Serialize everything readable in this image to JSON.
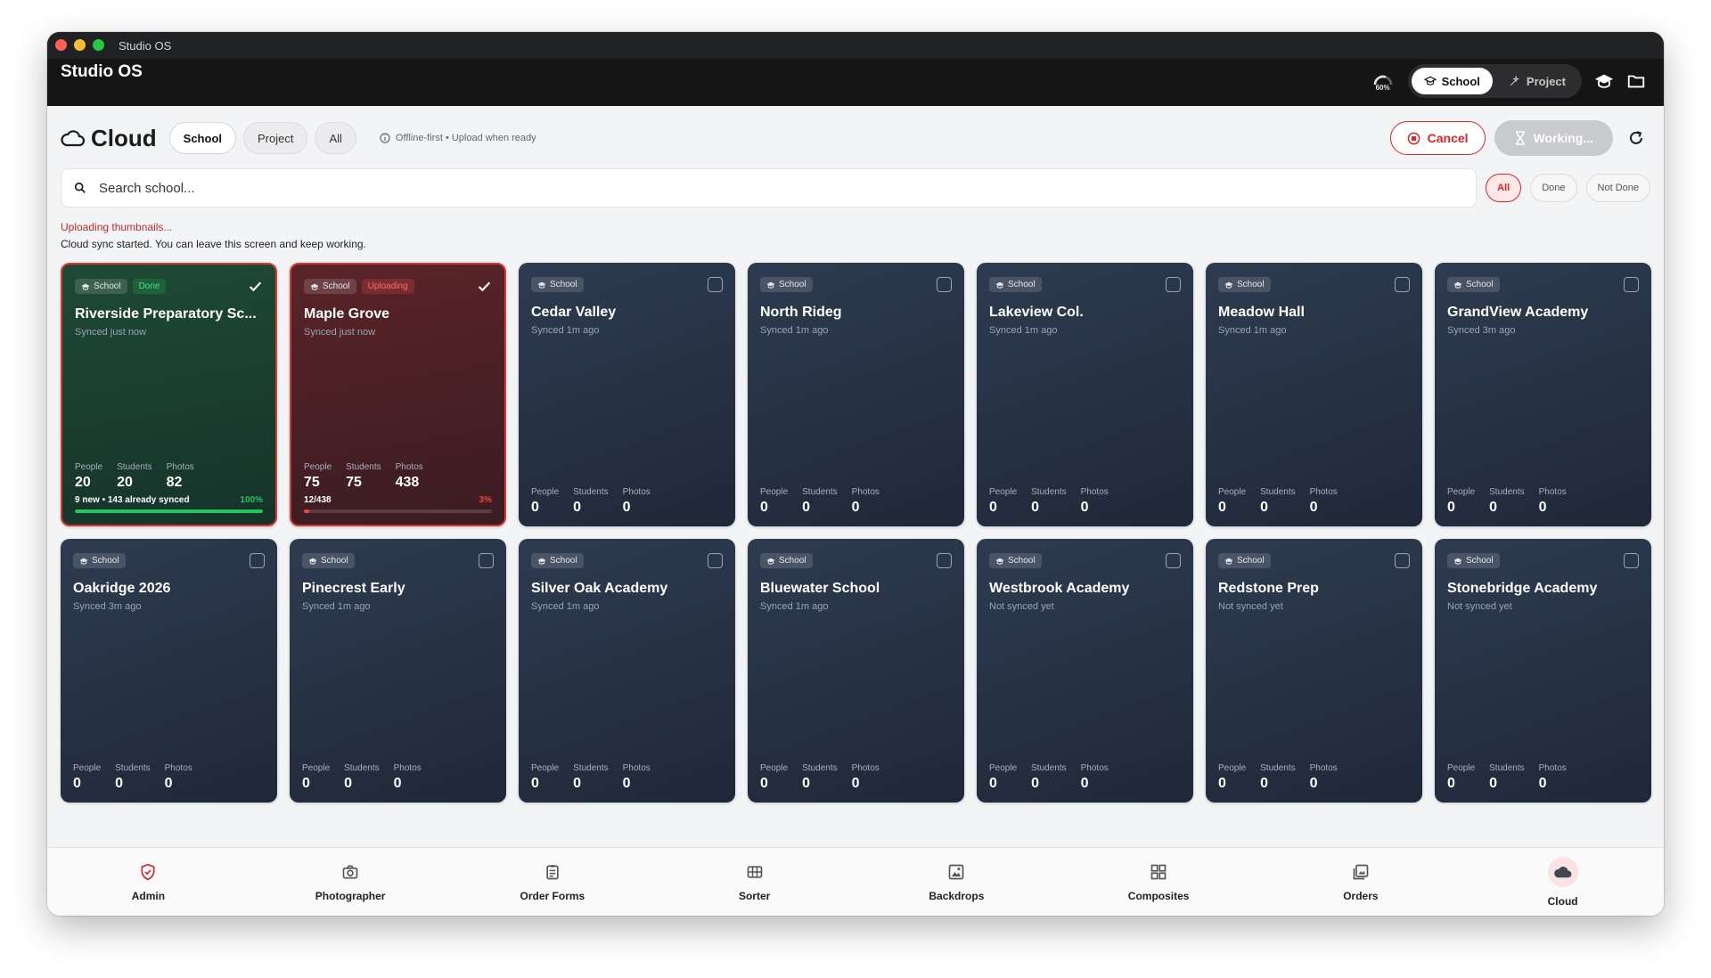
{
  "window": {
    "name": "Studio OS",
    "app_title": "Studio OS"
  },
  "topbar": {
    "battery_label": "60%",
    "modes": [
      {
        "label": "School",
        "icon": "graduation-cap-icon",
        "active": true
      },
      {
        "label": "Project",
        "icon": "sparkle-icon",
        "active": false
      }
    ]
  },
  "header": {
    "title": "Cloud",
    "tabs": [
      {
        "label": "School",
        "active": true
      },
      {
        "label": "Project",
        "active": false
      },
      {
        "label": "All",
        "active": false
      }
    ],
    "offline_note": "Offline-first • Upload when ready",
    "cancel_label": "Cancel",
    "working_label": "Working..."
  },
  "search": {
    "placeholder": "Search school..."
  },
  "filters": [
    {
      "label": "All",
      "active": true
    },
    {
      "label": "Done",
      "active": false
    },
    {
      "label": "Not Done",
      "active": false
    }
  ],
  "status": {
    "line1": "Uploading thumbnails...",
    "line2": "Cloud sync started. You can leave this screen and keep working."
  },
  "stat_labels": {
    "people": "People",
    "students": "Students",
    "photos": "Photos"
  },
  "cards": [
    {
      "name": "Riverside Preparatory Sc...",
      "badge": "School",
      "state_badge": "Done",
      "state": "done",
      "synced": "Synced just now",
      "people": "20",
      "students": "20",
      "photos": "82",
      "checked": true,
      "progress_text": "9 new • 143 already synced",
      "progress_pct": "100%",
      "progress": 1.0
    },
    {
      "name": "Maple Grove",
      "badge": "School",
      "state_badge": "Uploading",
      "state": "uploading",
      "synced": "Synced just now",
      "people": "75",
      "students": "75",
      "photos": "438",
      "checked": true,
      "progress_text": "12/438",
      "progress_pct": "3%",
      "progress": 0.03
    },
    {
      "name": "Cedar Valley",
      "badge": "School",
      "synced": "Synced 1m ago",
      "people": "0",
      "students": "0",
      "photos": "0",
      "checked": false
    },
    {
      "name": "North Rideg",
      "badge": "School",
      "synced": "Synced 1m ago",
      "people": "0",
      "students": "0",
      "photos": "0",
      "checked": false
    },
    {
      "name": "Lakeview Col.",
      "badge": "School",
      "synced": "Synced 1m ago",
      "people": "0",
      "students": "0",
      "photos": "0",
      "checked": false
    },
    {
      "name": "Meadow Hall",
      "badge": "School",
      "synced": "Synced 1m ago",
      "people": "0",
      "students": "0",
      "photos": "0",
      "checked": false
    },
    {
      "name": "GrandView Academy",
      "badge": "School",
      "synced": "Synced 3m ago",
      "people": "0",
      "students": "0",
      "photos": "0",
      "checked": false
    },
    {
      "name": "Oakridge 2026",
      "badge": "School",
      "synced": "Synced 3m ago",
      "people": "0",
      "students": "0",
      "photos": "0",
      "checked": false
    },
    {
      "name": "Pinecrest Early",
      "badge": "School",
      "synced": "Synced 1m ago",
      "people": "0",
      "students": "0",
      "photos": "0",
      "checked": false
    },
    {
      "name": "Silver Oak Academy",
      "badge": "School",
      "synced": "Synced 1m ago",
      "people": "0",
      "students": "0",
      "photos": "0",
      "checked": false
    },
    {
      "name": "Bluewater School",
      "badge": "School",
      "synced": "Synced 1m ago",
      "people": "0",
      "students": "0",
      "photos": "0",
      "checked": false
    },
    {
      "name": "Westbrook Academy",
      "badge": "School",
      "synced": "Not synced yet",
      "people": "0",
      "students": "0",
      "photos": "0",
      "checked": false
    },
    {
      "name": "Redstone Prep",
      "badge": "School",
      "synced": "Not synced yet",
      "people": "0",
      "students": "0",
      "photos": "0",
      "checked": false
    },
    {
      "name": "Stonebridge Academy",
      "badge": "School",
      "synced": "Not synced yet",
      "people": "0",
      "students": "0",
      "photos": "0",
      "checked": false
    }
  ],
  "nav": [
    {
      "label": "Admin",
      "icon": "shield-check-icon",
      "active": false
    },
    {
      "label": "Photographer",
      "icon": "camera-icon",
      "active": false
    },
    {
      "label": "Order Forms",
      "icon": "clipboard-icon",
      "active": false
    },
    {
      "label": "Sorter",
      "icon": "grid-sorter-icon",
      "active": false
    },
    {
      "label": "Backdrops",
      "icon": "image-frame-icon",
      "active": false
    },
    {
      "label": "Composites",
      "icon": "layout-grid-icon",
      "active": false
    },
    {
      "label": "Orders",
      "icon": "photo-stack-icon",
      "active": false
    },
    {
      "label": "Cloud",
      "icon": "cloud-icon",
      "active": true
    }
  ],
  "colors": {
    "accent_red": "#dc2626",
    "done_green": "#22c55e",
    "card_bg": "#2a3547"
  }
}
